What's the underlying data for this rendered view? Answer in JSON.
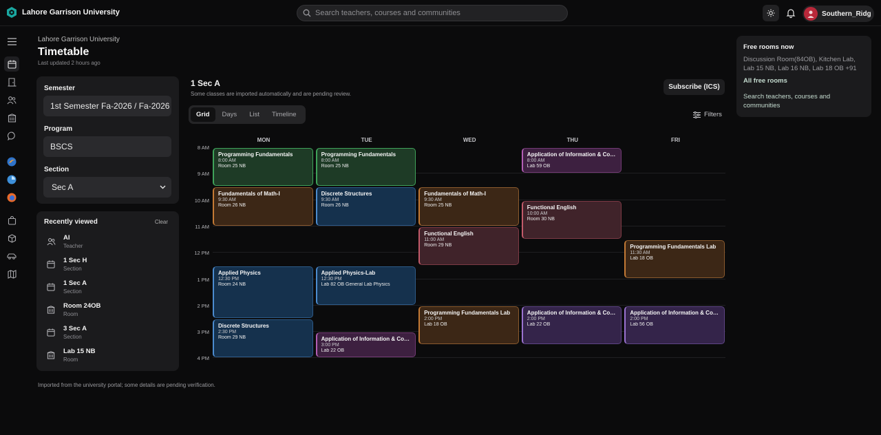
{
  "app": {
    "name": "Lahore Garrison University",
    "brand_color": "#1aa7a0"
  },
  "search": {
    "placeholder": "Search teachers, courses and communities"
  },
  "user": {
    "name": "Southern_Ridg..."
  },
  "header": {
    "breadcrumb": "Lahore Garrison University",
    "title": "Timetable",
    "updated": "Last updated 2 hours ago"
  },
  "filters": {
    "semester_label": "Semester",
    "semester_value": "1st Semester Fa-2026 / Fa-2026",
    "program_label": "Program",
    "program_value": "BSCS",
    "section_label": "Section",
    "section_value": "Sec A"
  },
  "recent": {
    "title": "Recently viewed",
    "clear": "Clear",
    "items": [
      {
        "name": "AI",
        "type": "Teacher",
        "icon": "users-icon"
      },
      {
        "name": "1 Sec H",
        "type": "Section",
        "icon": "calendar-icon"
      },
      {
        "name": "1 Sec A",
        "type": "Section",
        "icon": "calendar-icon"
      },
      {
        "name": "Room 24OB",
        "type": "Room",
        "icon": "building-icon"
      },
      {
        "name": "3 Sec A",
        "type": "Section",
        "icon": "calendar-icon"
      },
      {
        "name": "Lab 15 NB",
        "type": "Room",
        "icon": "building-icon"
      }
    ]
  },
  "footnote": "Imported from the university portal; some details are pending verification.",
  "timetable": {
    "title": "1 Sec A",
    "subtitle": "Some classes are imported automatically and are pending review.",
    "subscribe": "Subscribe (ICS)",
    "filters": "Filters",
    "views": [
      "Grid",
      "Days",
      "List",
      "Timeline"
    ],
    "active_view": "Grid",
    "days": [
      "MON",
      "TUE",
      "WED",
      "THU",
      "FRI"
    ],
    "hours": [
      "8 AM",
      "9 AM",
      "10 AM",
      "11 AM",
      "12 PM",
      "1 PM",
      "2 PM",
      "3 PM",
      "4 PM"
    ],
    "events": [
      {
        "day": 0,
        "start": 8.0,
        "end": 9.5,
        "title": "Programming Fundamentals",
        "time": "8:00 AM",
        "room": "Room 25 NB",
        "color": "green"
      },
      {
        "day": 0,
        "start": 9.5,
        "end": 11.0,
        "title": "Fundamentals of Math-I",
        "time": "9:30 AM",
        "room": "Room 26 NB",
        "color": "brown"
      },
      {
        "day": 0,
        "start": 12.5,
        "end": 14.5,
        "title": "Applied Physics",
        "time": "12:30 PM",
        "room": "Room 24 NB",
        "color": "blue"
      },
      {
        "day": 0,
        "start": 14.5,
        "end": 16.0,
        "title": "Discrete Structures",
        "time": "2:30 PM",
        "room": "Room 29 NB",
        "color": "blue"
      },
      {
        "day": 1,
        "start": 8.0,
        "end": 9.5,
        "title": "Programming Fundamentals",
        "time": "8:00 AM",
        "room": "Room 25 NB",
        "color": "green"
      },
      {
        "day": 1,
        "start": 9.5,
        "end": 11.0,
        "title": "Discrete Structures",
        "time": "9:30 AM",
        "room": "Room 26 NB",
        "color": "blue"
      },
      {
        "day": 1,
        "start": 12.5,
        "end": 14.0,
        "title": "Applied Physics-Lab",
        "time": "12:30 PM",
        "room": "Lab 82 OB General Lab Physics",
        "color": "blue"
      },
      {
        "day": 1,
        "start": 15.0,
        "end": 16.0,
        "title": "Application of Information & Communication Technologies",
        "time": "3:00 PM",
        "room": "Lab 22 OB",
        "color": "plum"
      },
      {
        "day": 2,
        "start": 9.5,
        "end": 11.0,
        "title": "Fundamentals of Math-I",
        "time": "9:30 AM",
        "room": "Room 25 NB",
        "color": "brown"
      },
      {
        "day": 2,
        "start": 11.0,
        "end": 12.5,
        "title": "Functional English",
        "time": "11:00 AM",
        "room": "Room 29 NB",
        "color": "maroon"
      },
      {
        "day": 2,
        "start": 14.0,
        "end": 15.5,
        "title": "Programming Fundamentals Lab",
        "time": "2:00 PM",
        "room": "Lab 18 OB",
        "color": "brown"
      },
      {
        "day": 3,
        "start": 8.0,
        "end": 9.0,
        "title": "Application of Information & Communication Technologies",
        "time": "8:00 AM",
        "room": "Lab 59 OB",
        "color": "plum"
      },
      {
        "day": 3,
        "start": 10.0,
        "end": 11.5,
        "title": "Functional English",
        "time": "10:00 AM",
        "room": "Room 30 NB",
        "color": "maroon"
      },
      {
        "day": 3,
        "start": 14.0,
        "end": 15.5,
        "title": "Application of Information & Communication Technologies",
        "time": "2:00 PM",
        "room": "Lab 22 OB",
        "color": "purple"
      },
      {
        "day": 4,
        "start": 11.5,
        "end": 13.0,
        "title": "Programming Fundamentals Lab",
        "time": "11:30 AM",
        "room": "Lab 18 OB",
        "color": "brown"
      },
      {
        "day": 4,
        "start": 14.0,
        "end": 15.5,
        "title": "Application of Information & Communication Technologies",
        "time": "2:00 PM",
        "room": "Lab 56 OB",
        "color": "purple"
      }
    ]
  },
  "free_rooms": {
    "title": "Free rooms now",
    "list": "Discussion Room(84OB), Kitchen Lab, Lab 15 NB, Lab 16 NB, Lab 18 OB +91",
    "all_link": "All free rooms",
    "search_link": "Search teachers, courses and communities"
  }
}
